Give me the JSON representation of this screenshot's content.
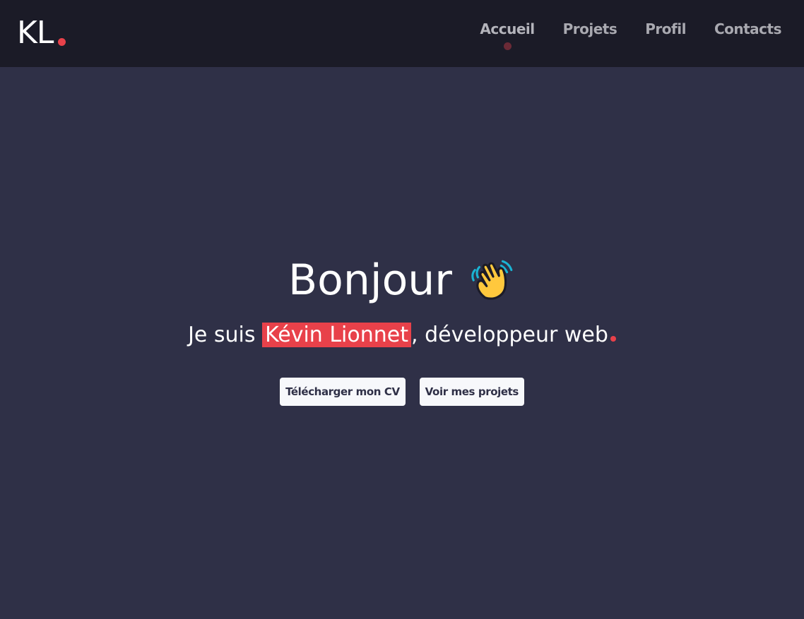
{
  "navbar": {
    "logo_text": "KL",
    "links": [
      {
        "label": "Accueil",
        "active": true
      },
      {
        "label": "Projets",
        "active": false
      },
      {
        "label": "Profil",
        "active": false
      },
      {
        "label": "Contacts",
        "active": false
      }
    ]
  },
  "hero": {
    "title": "Bonjour",
    "title_icon": "waving-hand",
    "subtitle_prefix": "Je suis ",
    "name": "Kévin Lionnet",
    "subtitle_suffix": ", développeur web"
  },
  "buttons": {
    "download_cv": "Télécharger mon CV",
    "view_projects": "Voir mes projets"
  },
  "colors": {
    "background": "#2f3047",
    "navbar": "#1b1b27",
    "accent": "#e8414a",
    "button_bg": "#f7f8fb"
  }
}
